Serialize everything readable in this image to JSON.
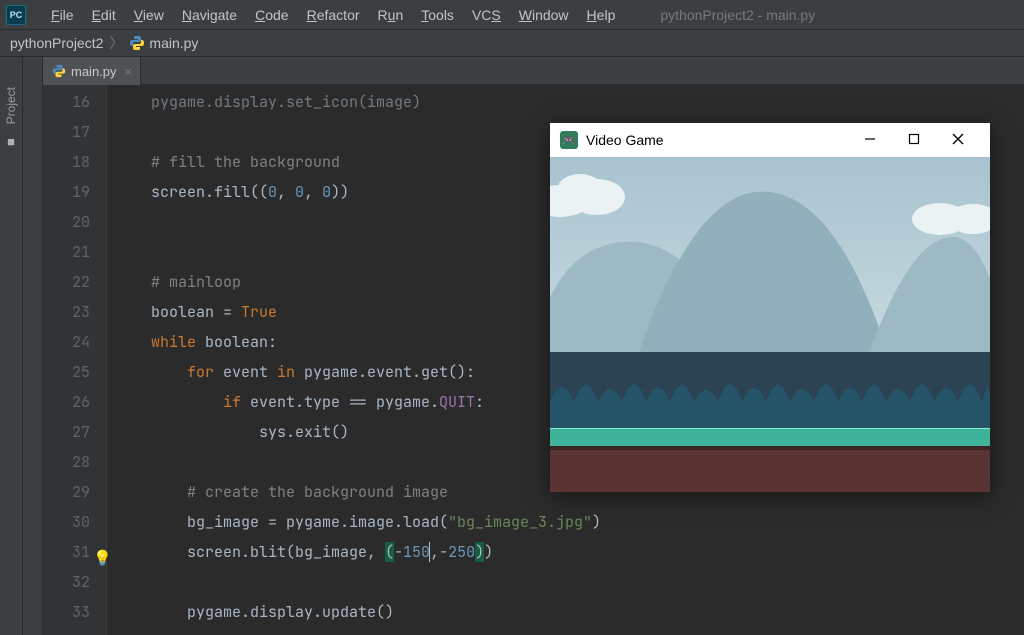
{
  "menubar": {
    "logo": "PC",
    "items": [
      "File",
      "Edit",
      "View",
      "Navigate",
      "Code",
      "Refactor",
      "Run",
      "Tools",
      "VCS",
      "Window",
      "Help"
    ],
    "window_title": "pythonProject2 - main.py"
  },
  "breadcrumb": {
    "project": "pythonProject2",
    "file": "main.py"
  },
  "side_strip": {
    "project_label": "Project"
  },
  "tab": {
    "label": "main.py"
  },
  "gutter": {
    "start": 16,
    "end": 33,
    "bulb_at": 31
  },
  "code": {
    "l16": "pygame.display.set_icon(image)",
    "l17": "",
    "l18": "# fill the background",
    "l19a": "screen.fill((",
    "l19b": "0",
    "l19c": ", ",
    "l19d": "0",
    "l19e": ", ",
    "l19f": "0",
    "l19g": "))",
    "l20": "",
    "l21": "",
    "l22": "# mainloop",
    "l23a": "boolean = ",
    "l23b": "True",
    "l24a": "while ",
    "l24b": "boolean:",
    "l25a": "    for ",
    "l25b": "event ",
    "l25c": "in ",
    "l25d": "pygame.event.get():",
    "l26a": "        if ",
    "l26b": "event.type == pygame.",
    "l26c": "QUIT",
    "l26d": ":",
    "l27": "            sys.exit()",
    "l28": "",
    "l29": "    # create the background image",
    "l30a": "    bg_image = pygame.image.load(",
    "l30b": "\"bg_image_3.jpg\"",
    "l30c": ")",
    "l31a": "    screen.blit(bg_image, ",
    "l31b": "(",
    "l31c": "-",
    "l31d": "150",
    "l31e": ",",
    "l31f": "-",
    "l31g": "250",
    "l31h": ")",
    "l31i": ")",
    "l32": "",
    "l33": "    pygame.display.update()"
  },
  "game_window": {
    "title": "Video Game"
  }
}
